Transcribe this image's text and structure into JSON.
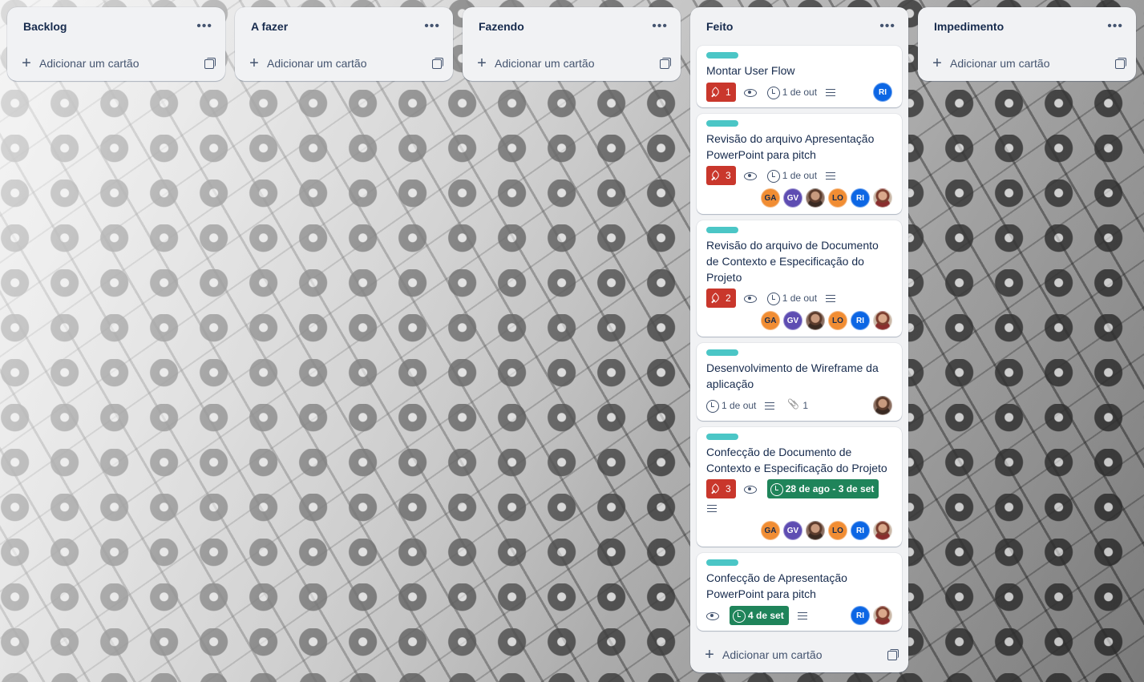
{
  "add_card_label": "Adicionar um cartão",
  "menu_glyph": "•••",
  "label_color": "#4bc6c6",
  "lists": [
    {
      "title": "Backlog"
    },
    {
      "title": "A fazer"
    },
    {
      "title": "Fazendo"
    },
    {
      "title": "Feito"
    },
    {
      "title": "Impedimento"
    }
  ],
  "feito_cards": [
    {
      "title": "Montar User Flow",
      "pins": "1",
      "watching": true,
      "due": "1 de out",
      "has_description": true,
      "members": [
        "RI"
      ]
    },
    {
      "title": "Revisão do arquivo Apresentação PowerPoint para pitch",
      "pins": "3",
      "watching": true,
      "due": "1 de out",
      "has_description": true,
      "members": [
        "GA",
        "GV",
        "photo",
        "LO",
        "RI",
        "photo2"
      ]
    },
    {
      "title": "Revisão do arquivo de Documento de Contexto e Especificação do Projeto",
      "pins": "2",
      "watching": true,
      "due": "1 de out",
      "has_description": true,
      "members": [
        "GA",
        "GV",
        "photo",
        "LO",
        "RI",
        "photo2"
      ]
    },
    {
      "title": "Desenvolvimento de Wireframe da aplicação",
      "due": "1 de out",
      "has_description": true,
      "attachments": "1",
      "members": [
        "photo"
      ]
    },
    {
      "title": "Confecção de Documento de Contexto e Especificação do Projeto",
      "pins": "3",
      "watching": true,
      "due_range": "28 de ago - 3 de set",
      "due_complete_color": "#1f845a",
      "has_description": true,
      "members": [
        "GA",
        "GV",
        "photo",
        "LO",
        "RI",
        "photo2"
      ]
    },
    {
      "title": "Confecção de Apresentação PowerPoint para pitch",
      "watching": true,
      "due_range": "4 de set",
      "due_complete_color": "#1f845a",
      "has_description": true,
      "members": [
        "RI",
        "photo2"
      ]
    }
  ],
  "member_initials": {
    "GA": "GA",
    "GV": "GV",
    "LO": "LO",
    "RI": "RI"
  },
  "pin_badge_color": "#c9372c"
}
